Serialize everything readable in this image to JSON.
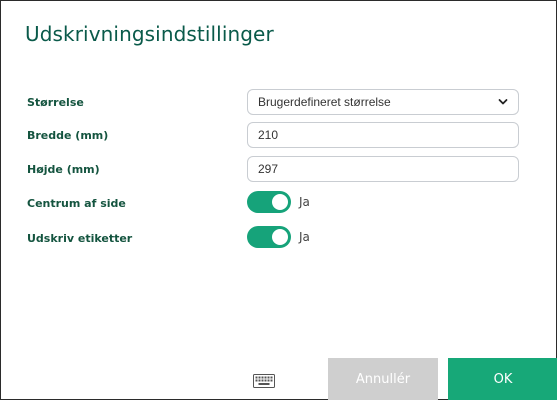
{
  "dialog": {
    "title": "Udskrivningsindstillinger"
  },
  "fields": {
    "size": {
      "label": "Størrelse",
      "value": "Brugerdefineret størrelse"
    },
    "width": {
      "label": "Bredde (mm)",
      "value": "210"
    },
    "height": {
      "label": "Højde (mm)",
      "value": "297"
    },
    "center": {
      "label": "Centrum af side",
      "state": true,
      "state_label": "Ja"
    },
    "labels": {
      "label": "Udskriv etiketter",
      "state": true,
      "state_label": "Ja"
    }
  },
  "footer": {
    "keyboard_icon": "keyboard-icon",
    "cancel_label": "Annullér",
    "ok_label": "OK"
  },
  "colors": {
    "title": "#0a5a4a",
    "label": "#14543f",
    "accent": "#16a37a",
    "cancel_button": "#cfcfcf",
    "ok_button": "#17a878"
  }
}
